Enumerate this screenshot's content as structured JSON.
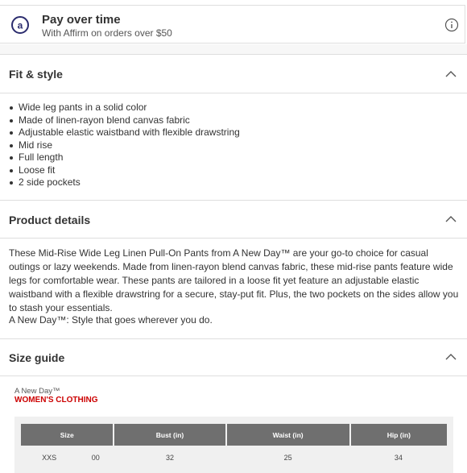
{
  "affirm": {
    "title": "Pay over time",
    "subtitle": "With Affirm on orders over $50",
    "logo_icon": "affirm-logo-icon",
    "info_icon": "info-icon"
  },
  "fit_style": {
    "title": "Fit & style",
    "bullets": [
      "Wide leg pants in a solid color",
      "Made of linen-rayon blend canvas fabric",
      "Adjustable elastic waistband with flexible drawstring",
      "Mid rise",
      "Full length",
      "Loose fit",
      "2 side pockets"
    ]
  },
  "product_details": {
    "title": "Product details",
    "paragraph1": "These Mid-Rise Wide Leg Linen Pull-On Pants from A New Day™ are your go-to choice for casual outings or lazy weekends. Made from linen-rayon blend canvas fabric, these mid-rise pants feature wide legs for comfortable wear. These pants are tailored in a loose fit yet feature an adjustable elastic waistband with a flexible drawstring for a secure, stay-put fit. Plus, the two pockets on the sides allow you to stash your essentials.",
    "paragraph2": "A New Day™: Style that goes wherever you do."
  },
  "size_guide": {
    "title": "Size guide",
    "brand": "A New Day™",
    "category": "WOMEN'S CLOTHING",
    "headers": [
      "Size",
      "Bust (in)",
      "Waist (in)",
      "Hip (in)"
    ],
    "rows": [
      {
        "size": "XXS",
        "num": "00",
        "bust": "32",
        "waist": "25",
        "hip": "34"
      }
    ]
  },
  "colors": {
    "accent_red": "#cc0000",
    "affirm_blue": "#2b2c6e",
    "table_header": "#6f6f6f"
  }
}
